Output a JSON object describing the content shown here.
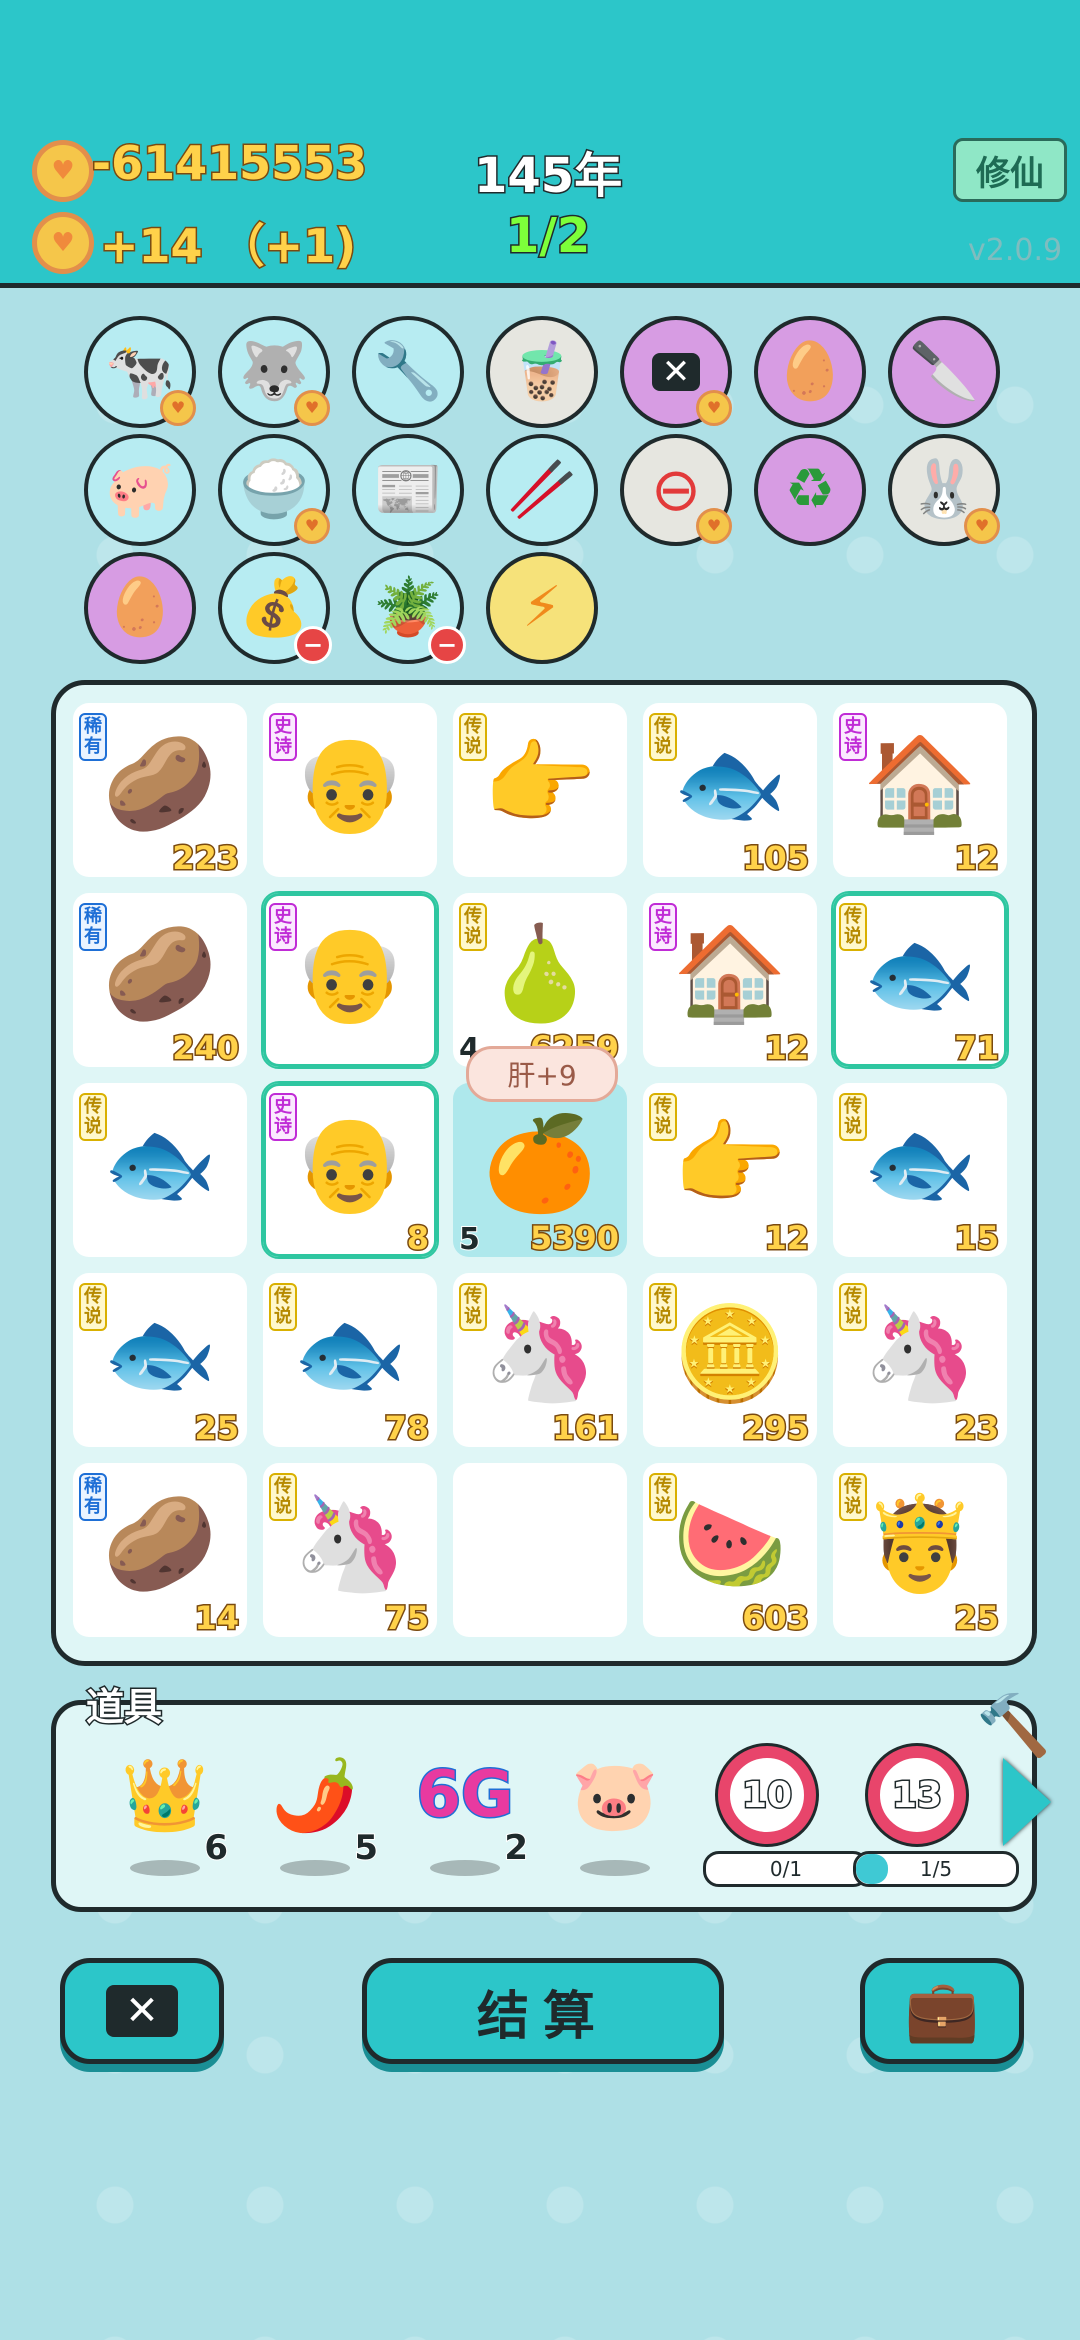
{
  "header": {
    "coins": "-61415553",
    "coin_rate": "+14 （+1)",
    "year": "145年",
    "progress": "1/2",
    "xiuxian_label": "修仙",
    "version": "v2.0.9"
  },
  "upgrades": {
    "row1": [
      "cows",
      "husky",
      "pump",
      "bubble-tea",
      "close-tag",
      "egg",
      "cleaver"
    ],
    "row2": [
      "piggy",
      "rice-bowl",
      "time-magazine",
      "straws",
      "minus",
      "recycle",
      "rabbit"
    ],
    "row3": [
      "egg",
      "sack",
      "flower-pot",
      "lightning"
    ]
  },
  "board": {
    "tip": "肝+9",
    "cells": [
      {
        "rarity": "稀有",
        "icon": "🥔",
        "count": "223"
      },
      {
        "rarity": "史诗",
        "icon": "👴",
        "count": ""
      },
      {
        "rarity": "传说",
        "icon": "👉",
        "count": ""
      },
      {
        "rarity": "传说",
        "icon": "🐟",
        "count": "105"
      },
      {
        "rarity": "史诗",
        "icon": "🏠",
        "count": "12"
      },
      {
        "rarity": "稀有",
        "icon": "🥔",
        "count": "240"
      },
      {
        "rarity": "史诗",
        "icon": "👴",
        "count": ""
      },
      {
        "rarity": "传说",
        "icon": "🍐",
        "count": "6259",
        "level": "4"
      },
      {
        "rarity": "史诗",
        "icon": "🏠",
        "count": "12"
      },
      {
        "rarity": "传说",
        "icon": "🐟",
        "count": "71"
      },
      {
        "rarity": "传说",
        "icon": "🐟",
        "count": ""
      },
      {
        "rarity": "史诗",
        "icon": "👴",
        "count": "8"
      },
      {
        "rarity": "",
        "icon": "🍊",
        "count": "5390",
        "level": "5"
      },
      {
        "rarity": "传说",
        "icon": "👉",
        "count": "12"
      },
      {
        "rarity": "传说",
        "icon": "🐟",
        "count": "15"
      },
      {
        "rarity": "传说",
        "icon": "🐟",
        "count": "25"
      },
      {
        "rarity": "传说",
        "icon": "🐟",
        "count": "78"
      },
      {
        "rarity": "传说",
        "icon": "🦄",
        "count": "161"
      },
      {
        "rarity": "传说",
        "icon": "🪙",
        "count": "295"
      },
      {
        "rarity": "传说",
        "icon": "🦄",
        "count": "23"
      },
      {
        "rarity": "稀有",
        "icon": "🥔",
        "count": "14"
      },
      {
        "rarity": "传说",
        "icon": "🦄",
        "count": "75"
      },
      {
        "rarity": "",
        "icon": "",
        "count": ""
      },
      {
        "rarity": "传说",
        "icon": "🍉",
        "count": "603"
      },
      {
        "rarity": "传说",
        "icon": "🤴",
        "count": "25"
      }
    ]
  },
  "props": {
    "label": "道具",
    "items": [
      {
        "icon": "👑",
        "count": "6"
      },
      {
        "icon": "🌶️",
        "count": "5"
      },
      {
        "icon": "6G",
        "count": "2"
      },
      {
        "icon": "🐷",
        "count": ""
      }
    ],
    "targets": [
      {
        "value": "10",
        "progress_text": "0/1",
        "progress": 0
      },
      {
        "value": "13",
        "progress_text": "1/5",
        "progress": 0.2
      }
    ]
  },
  "buttons": {
    "settle_label": "结算"
  },
  "colors": {
    "header_bg": "#2cc6c9",
    "board_bg": "#dff6f6",
    "coin_gold": "#ffd24a"
  }
}
